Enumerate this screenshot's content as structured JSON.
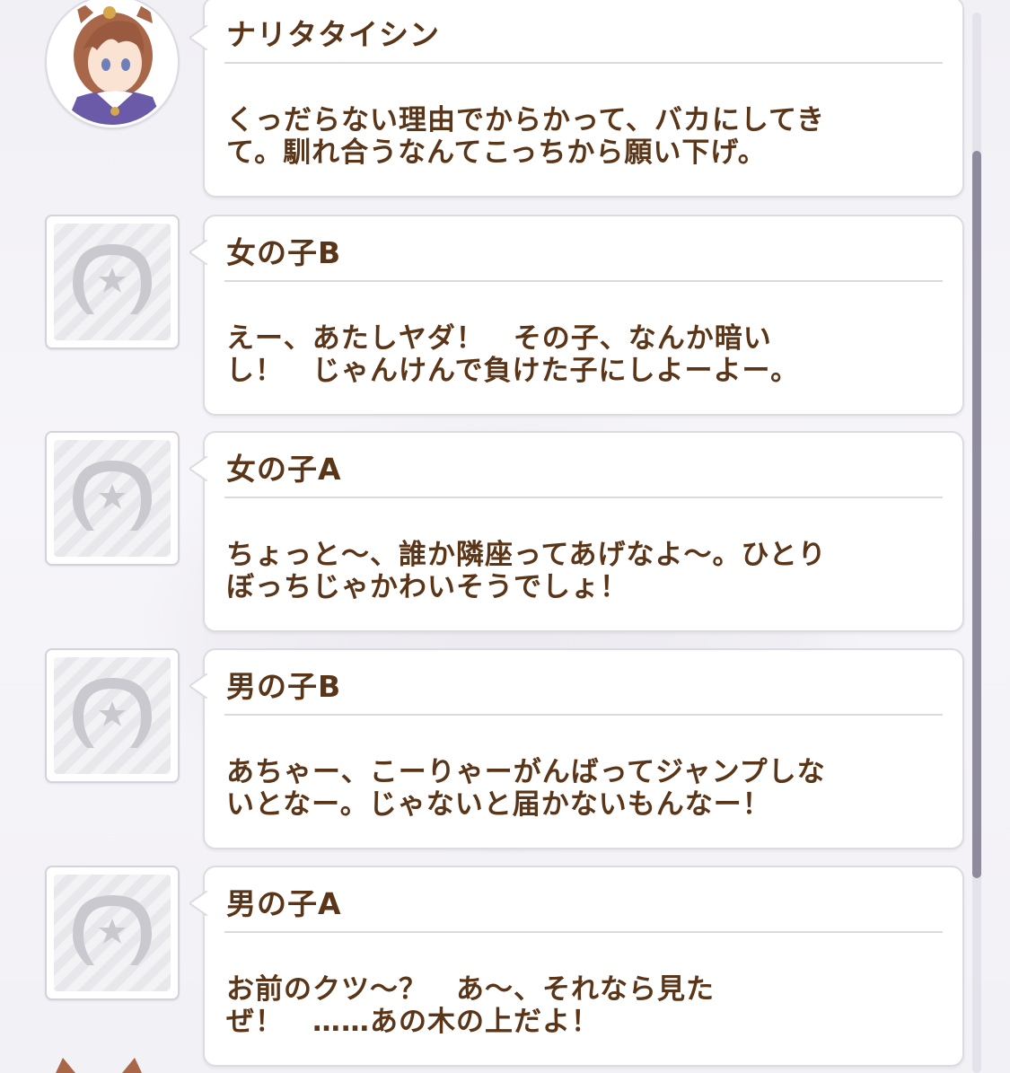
{
  "log": {
    "entries": [
      {
        "speaker": "ナリタタイシン",
        "text": "くっだらない理由でからかって、バカにしてき\nて。馴れ合うなんてこっちから願い下げ。",
        "avatar_icon": "character-portrait-icon"
      },
      {
        "speaker": "女の子B",
        "text": "えー、あたしヤダ！　その子、なんか暗い\nし！　じゃんけんで負けた子にしよーよー。",
        "avatar_icon": "horseshoe-placeholder-icon"
      },
      {
        "speaker": "女の子A",
        "text": "ちょっと～、誰か隣座ってあげなよ～。ひとり\nぼっちじゃかわいそうでしょ！",
        "avatar_icon": "horseshoe-placeholder-icon"
      },
      {
        "speaker": "男の子B",
        "text": "あちゃー、こーりゃーがんばってジャンプしな\nいとなー。じゃないと届かないもんなー！",
        "avatar_icon": "horseshoe-placeholder-icon"
      },
      {
        "speaker": "男の子A",
        "text": "お前のクツ～？　あ～、それなら見た\nぜ！　……あの木の上だよ！",
        "avatar_icon": "horseshoe-placeholder-icon"
      }
    ]
  },
  "colors": {
    "text_brown": "#5a3518",
    "bubble_border": "#dddbe2",
    "scroll_thumb": "#8f8a9c",
    "hair": "#a9674a",
    "uniform": "#6b5aa8"
  }
}
